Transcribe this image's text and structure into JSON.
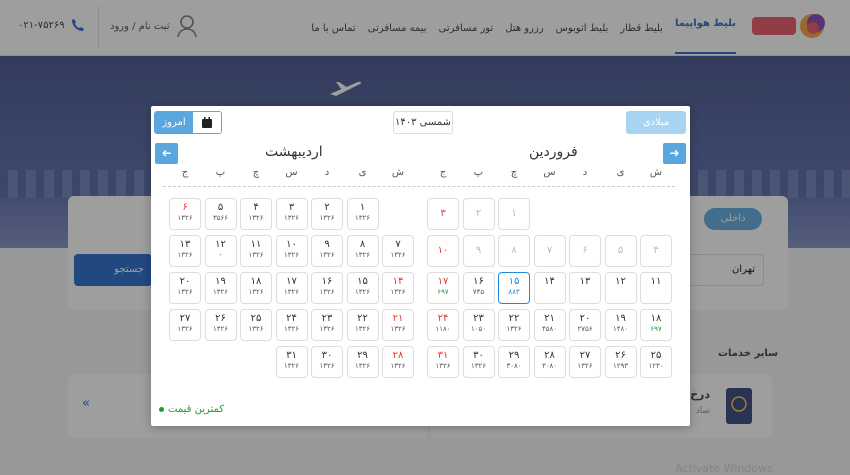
{
  "header": {
    "nav": [
      "بلیط هواپیما",
      "بلیط قطار",
      "بلیط اتوبوس",
      "رزرو هتل",
      "تور مسافرتی",
      "بیمه مسافرتی",
      "تماس با ما"
    ],
    "login": "ثبت نام / ورود",
    "phone": "۰۲۱-۷۵۲۶۹"
  },
  "background": {
    "tab_domestic": "داخلی",
    "origin_value": "تهران",
    "search_label": "جستجو",
    "services_title": "سایر خدمات",
    "service_card_title": "درخ",
    "service_card_sub": "ساد",
    "arrows": "«",
    "watermark": "Activate Windows"
  },
  "calendar": {
    "gregorian_button": "میلادی",
    "year": "۱۴۰۳ شمسی",
    "today_button": "امروز",
    "month_right": "فروردین",
    "month_left": "اردیبهشت",
    "weekdays": [
      "ش",
      "ی",
      "د",
      "س",
      "چ",
      "پ",
      "ج"
    ],
    "legend": "کمترین قیمت",
    "farvardin": [
      [
        null,
        null,
        null,
        null,
        "۱",
        "۲",
        "۳"
      ],
      [
        "۴",
        "۵",
        "۶",
        "۷",
        "۸",
        "۹",
        "۱۰"
      ],
      [
        "۱۱",
        "۱۲",
        "۱۳",
        "۱۴",
        "۱۵",
        "۱۶",
        "۱۷"
      ],
      [
        "۱۸",
        "۱۹",
        "۲۰",
        "۲۱",
        "۲۲",
        "۲۳",
        "۲۴"
      ],
      [
        "۲۵",
        "۲۶",
        "۲۷",
        "۲۸",
        "۲۹",
        "۳۰",
        "۳۱"
      ]
    ],
    "farvardin_prices": [
      [
        null,
        null,
        null,
        null,
        "",
        "",
        ""
      ],
      [
        "",
        "",
        "",
        "",
        "",
        "",
        ""
      ],
      [
        "",
        "",
        "",
        "",
        "۸۸۳",
        "۷۴۵",
        "۶۹۷"
      ],
      [
        "۶۹۷",
        "۱۴۸۰",
        "۲۷۵۶",
        "۴۵۸۰",
        "۱۳۲۶",
        "۱۰۵۰",
        "۱۱۸۰"
      ],
      [
        "۱۲۳۰",
        "۱۲۹۳",
        "۱۳۲۶",
        "۳۰۸۰",
        "۳۰۸۰",
        "۱۳۲۶",
        "۱۳۲۶"
      ]
    ],
    "ordibehesht": [
      [
        null,
        "۱",
        "۲",
        "۳",
        "۴",
        "۵",
        "۶",
        "۷"
      ],
      [
        "۸",
        "۹",
        "۱۰",
        "۱۱",
        "۱۲",
        "۱۳",
        "۱۴"
      ],
      [
        "۱۵",
        "۱۶",
        "۱۷",
        "۱۸",
        "۱۹",
        "۲۰",
        "۲۱"
      ],
      [
        "۲۲",
        "۲۳",
        "۲۴",
        "۲۵",
        "۲۶",
        "۲۷",
        "۲۸"
      ],
      [
        "۲۹",
        "۳۰",
        "۳۱"
      ]
    ],
    "ordibehesht_prices": [
      [
        null,
        "۱۳۲۶",
        "۱۳۲۶",
        "۱۳۲۶",
        "۱۳۲۶",
        "۳۵۶۶",
        "۱۳۲۶",
        "۱۳۲۶"
      ],
      [
        "۱۳۲۶",
        "۱۳۲۶",
        "۱۳۲۶",
        "۱۳۲۶",
        "-",
        "۱۳۲۶",
        "۱۳۲۶"
      ],
      [
        "۱۳۲۶",
        "۱۳۲۶",
        "۱۳۲۶",
        "۱۳۲۶",
        "۱۳۲۶",
        "۱۳۲۶",
        "۱۳۲۶"
      ],
      [
        "۱۳۲۶",
        "۱۳۲۶",
        "۱۳۲۶",
        "۱۳۲۶",
        "۱۳۲۶",
        "۱۳۲۶",
        "۱۳۲۶"
      ],
      [
        "۱۳۲۶",
        "۱۳۲۶",
        "۱۳۲۶"
      ]
    ]
  },
  "colors": {
    "accent": "#5aa7e0",
    "selected": "#1e88e5",
    "holiday": "#e53935",
    "cheapest": "#1b9e3a"
  }
}
